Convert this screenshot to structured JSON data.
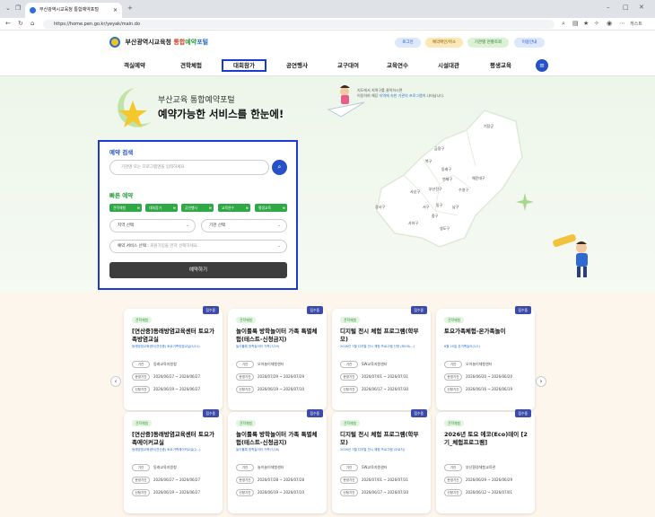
{
  "browser": {
    "tab_title": "부산광역시교육청 통합예약포털",
    "tab_close": "×",
    "new_tab": "+",
    "url": "https://home.pen.go.kr/yeyak/main.do",
    "profile_label": "게스트"
  },
  "header": {
    "logo_org": "부산광역시교육청",
    "logo_brand_a": "통합",
    "logo_brand_b": "예약",
    "logo_brand_c": "포털",
    "util_buttons": [
      "로그인",
      "예약확인/취소",
      "기관별 현황조회",
      "이용안내"
    ]
  },
  "menu": {
    "items": [
      "객실예약",
      "견학체험",
      "대회참가",
      "공연행사",
      "교구대여",
      "교육연수",
      "시설대관",
      "평생교육"
    ],
    "selected_index": 2,
    "menu_icon": "hamburger-icon"
  },
  "hero": {
    "subtitle": "부산교육 통합예약포털",
    "title": "예약가능한 서비스를 한눈에!",
    "map_note_1": "지도에서 지역구를 클릭하시면",
    "map_note_2": "이동하여 해당",
    "map_note_3": "지역에 속한 기관의 프로그램",
    "map_note_4": "이 나타납니다."
  },
  "search_panel": {
    "title": "예약 검색",
    "search_placeholder": "기관명 또는 프로그램명을 입력하세요",
    "quick_title": "빠른 예약",
    "quick_buttons": [
      "견학체험",
      "대회참가",
      "공연행사",
      "교육연수",
      "평생교육"
    ],
    "region_select": "지역 선택",
    "org_select": "기관 선택",
    "service_label": "예약 서비스 선택 :",
    "service_placeholder": "회원가입을 먼저 선택하세요.",
    "submit_label": "예약하기"
  },
  "map_regions": [
    "기장군",
    "금정구",
    "북구",
    "동래구",
    "해운대구",
    "연제구",
    "강서구",
    "사상구",
    "부산진구",
    "수영구",
    "서구",
    "동구",
    "남구",
    "중구",
    "사하구",
    "영도구"
  ],
  "cards": [
    {
      "category": "견학체험",
      "status": "접수중",
      "title": "[연산중]동래방염교육센터 토요가족방염교실",
      "subtitle": "동래방염교육센터(연산중) 토요가족방염교실(5/11)",
      "org_label": "기관",
      "org": "동래교육지원청",
      "run_label": "운영기간",
      "run": "2026/06/27 ~ 2026/06/27",
      "apply_label": "신청기간",
      "apply": "2026/06/19 ~ 2026/06/27"
    },
    {
      "category": "견학체험",
      "status": "접수중",
      "title": "놀이룰룩 방학놀이터 가족 특별체험(테스트-신청금지)",
      "subtitle": "놀이룰룩 방학놀이터 가족(7/29)",
      "org_label": "기관",
      "org": "오아놀이체험센터",
      "run_label": "운영기간",
      "run": "2026/07/29 ~ 2026/07/29",
      "apply_label": "신청기간",
      "apply": "2026/06/19 ~ 2026/07/10"
    },
    {
      "category": "견학체험",
      "status": "접수중",
      "title": "디지털 전시 체험 프로그램(학부모)",
      "subtitle": "2026년 7월 디지털 전시 체험 프로그램 신청 (테스트...)",
      "org_label": "기관",
      "org": "SW교육지원센터",
      "run_label": "운영기간",
      "run": "2026/07/01 ~ 2026/07/31",
      "apply_label": "신청기간",
      "apply": "2026/06/17 ~ 2026/07/30"
    },
    {
      "category": "견학체험",
      "status": "접수중",
      "title": "토요가족체험-온가족놀이",
      "subtitle": "6월 20일 온가족놀이(1/2)",
      "org_label": "기관",
      "org": "오아놀이체험센터",
      "run_label": "운영기간",
      "run": "2026/06/20 ~ 2026/06/20",
      "apply_label": "신청기간",
      "apply": "2026/06/16 ~ 2026/06/19"
    },
    {
      "category": "견학체험",
      "status": "접수중",
      "title": "[연산중]동래방염교육센터 토요가족에이커교실",
      "subtitle": "동래방염교육센터(연산중) 토요가족에이커교실(2...)",
      "org_label": "기관",
      "org": "동래교육지원청",
      "run_label": "운영기간",
      "run": "2026/06/27 ~ 2026/06/27",
      "apply_label": "신청기간",
      "apply": "2026/06/19 ~ 2026/06/27"
    },
    {
      "category": "견학체험",
      "status": "접수중",
      "title": "놀이룰룩 방학놀이터 가족 특별체험(테스트-신청금지)",
      "subtitle": "놀이룰룩 방학놀이터 가족(7/28)",
      "org_label": "기관",
      "org": "놀이놀이체험센터",
      "run_label": "운영기간",
      "run": "2026/07/28 ~ 2026/07/28",
      "apply_label": "신청기간",
      "apply": "2026/06/19 ~ 2026/07/10"
    },
    {
      "category": "견학체험",
      "status": "접수중",
      "title": "디지털 전시 체험 프로그램(학부모)",
      "subtitle": "2026년 7월 디지털 전시 체험 프로그램 (오로지)",
      "org_label": "기관",
      "org": "SW교육지원센터",
      "run_label": "운영기간",
      "run": "2026/07/01 ~ 2026/07/31",
      "apply_label": "신청기간",
      "apply": "2026/06/17 ~ 2026/07/30"
    },
    {
      "category": "견학체험",
      "status": "접수중",
      "title": "2026년 토요 에코(Eco)데이 [2기_체험프로그램]",
      "subtitle": "",
      "org_label": "기관",
      "org": "부산환경체험교육관",
      "run_label": "운영기간",
      "run": "2026/06/29 ~ 2026/06/29",
      "apply_label": "신청기간",
      "apply": "2026/06/12 ~ 2026/07/01"
    }
  ],
  "carousel": {
    "prev": "‹",
    "next": "›"
  },
  "colors": {
    "primary": "#2752c7",
    "green": "#2fa846",
    "highlight": "#1d39d6",
    "status": "#3c4ba8"
  }
}
